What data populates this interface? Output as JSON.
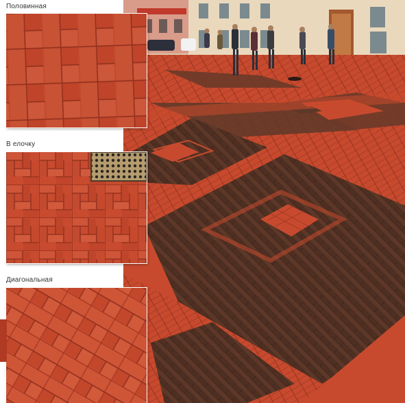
{
  "panels": [
    {
      "label": "Половинная",
      "pattern": "running-bond"
    },
    {
      "label": "В елочку",
      "pattern": "herringbone"
    },
    {
      "label": "Диагональная",
      "pattern": "diagonal-herringbone"
    }
  ],
  "photo": {
    "subject": "paved-square-with-pedestrians"
  },
  "colors": {
    "brick_red": "#c2442a",
    "brick_red_light": "#cf5236",
    "brick_brown": "#5a3527",
    "mortar": "#8e2f1d",
    "building_cream": "#e6d2b4",
    "accent_tab": "#b03a24"
  }
}
